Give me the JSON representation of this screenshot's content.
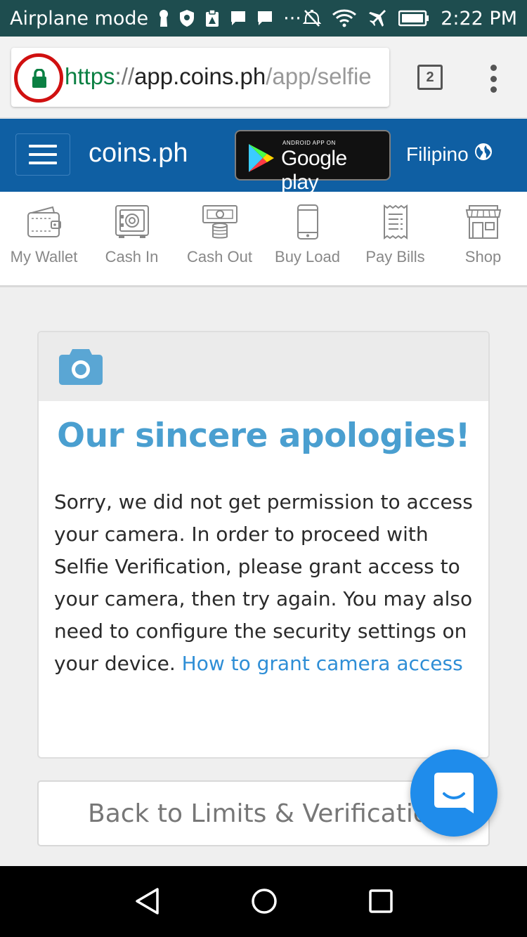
{
  "status_bar": {
    "mode_text": "Airplane mode",
    "dots": "···",
    "time": "2:22 PM"
  },
  "browser": {
    "url_scheme": "https",
    "url_sep": "://",
    "url_host": "app.coins.ph",
    "url_path": "/app/selfie",
    "tab_count": "2"
  },
  "nav": {
    "brand": "coins.ph",
    "store_badge_small": "ANDROID APP ON",
    "store_badge_big": "Google play",
    "language": "Filipino"
  },
  "services": [
    {
      "label": "My Wallet",
      "icon": "wallet-icon"
    },
    {
      "label": "Cash In",
      "icon": "safe-icon"
    },
    {
      "label": "Cash Out",
      "icon": "cash-out-icon"
    },
    {
      "label": "Buy Load",
      "icon": "phone-icon"
    },
    {
      "label": "Pay Bills",
      "icon": "receipt-icon"
    },
    {
      "label": "Shop",
      "icon": "shop-icon"
    }
  ],
  "card": {
    "title": "Our sincere apologies!",
    "body": "Sorry, we did not get permission to access your camera. In order to proceed with Selfie Verification, please grant access to your camera, then try again. You may also need to configure the security settings on your device.",
    "link": "How to grant camera access"
  },
  "back_button": "Back to Limits & Verification",
  "colors": {
    "status_bar": "#1e4d4f",
    "nav_bg": "#0f5fa3",
    "title_blue": "#4a9fd0",
    "link_blue": "#2e8ed6",
    "chat_blue": "#1f8ceb",
    "lock_green": "#0b8043",
    "highlight_red": "#d01010"
  }
}
